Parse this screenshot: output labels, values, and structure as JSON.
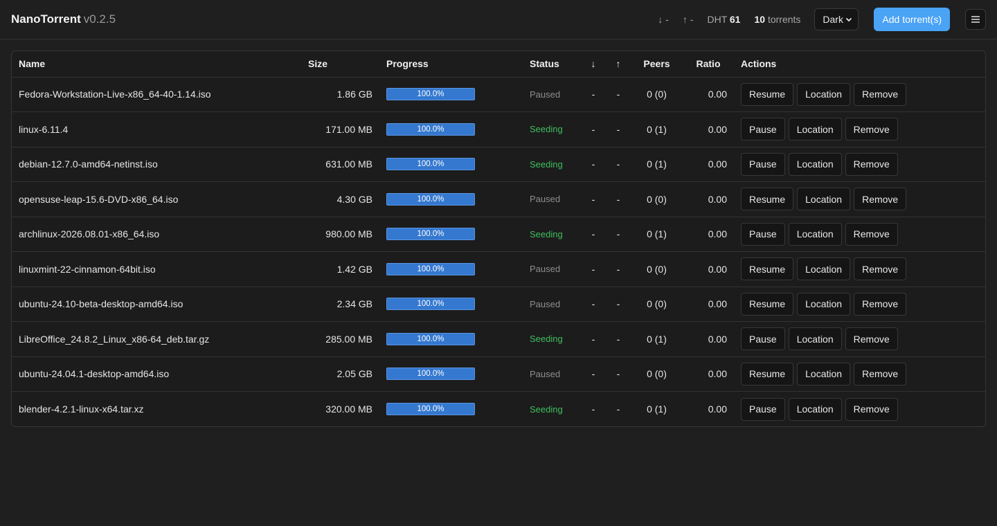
{
  "app": {
    "name": "NanoTorrent",
    "version": "v0.2.5"
  },
  "header": {
    "down_label": "↓ -",
    "up_label": "↑ -",
    "dht_label": "DHT",
    "dht_value": "61",
    "torrent_count": "10",
    "torrent_label": "torrents",
    "theme": "Dark",
    "add_button": "Add torrent(s)",
    "menu_icon": "hamburger-menu-icon"
  },
  "table": {
    "columns": [
      "Name",
      "Size",
      "Progress",
      "Status",
      "↓",
      "↑",
      "Peers",
      "Ratio",
      "Actions"
    ],
    "rows": [
      {
        "name": "Fedora-Workstation-Live-x86_64-40-1.14.iso",
        "size": "1.86 GB",
        "progress": 100.0,
        "progress_label": "100.0%",
        "status": "Paused",
        "down": "-",
        "up": "-",
        "peers": "0 (0)",
        "ratio": "0.00",
        "actions": [
          "Resume",
          "Location",
          "Remove"
        ]
      },
      {
        "name": "linux-6.11.4",
        "size": "171.00 MB",
        "progress": 100.0,
        "progress_label": "100.0%",
        "status": "Seeding",
        "down": "-",
        "up": "-",
        "peers": "0 (1)",
        "ratio": "0.00",
        "actions": [
          "Pause",
          "Location",
          "Remove"
        ]
      },
      {
        "name": "debian-12.7.0-amd64-netinst.iso",
        "size": "631.00 MB",
        "progress": 100.0,
        "progress_label": "100.0%",
        "status": "Seeding",
        "down": "-",
        "up": "-",
        "peers": "0 (1)",
        "ratio": "0.00",
        "actions": [
          "Pause",
          "Location",
          "Remove"
        ]
      },
      {
        "name": "opensuse-leap-15.6-DVD-x86_64.iso",
        "size": "4.30 GB",
        "progress": 100.0,
        "progress_label": "100.0%",
        "status": "Paused",
        "down": "-",
        "up": "-",
        "peers": "0 (0)",
        "ratio": "0.00",
        "actions": [
          "Resume",
          "Location",
          "Remove"
        ]
      },
      {
        "name": "archlinux-2026.08.01-x86_64.iso",
        "size": "980.00 MB",
        "progress": 100.0,
        "progress_label": "100.0%",
        "status": "Seeding",
        "down": "-",
        "up": "-",
        "peers": "0 (1)",
        "ratio": "0.00",
        "actions": [
          "Pause",
          "Location",
          "Remove"
        ]
      },
      {
        "name": "linuxmint-22-cinnamon-64bit.iso",
        "size": "1.42 GB",
        "progress": 100.0,
        "progress_label": "100.0%",
        "status": "Paused",
        "down": "-",
        "up": "-",
        "peers": "0 (0)",
        "ratio": "0.00",
        "actions": [
          "Resume",
          "Location",
          "Remove"
        ]
      },
      {
        "name": "ubuntu-24.10-beta-desktop-amd64.iso",
        "size": "2.34 GB",
        "progress": 100.0,
        "progress_label": "100.0%",
        "status": "Paused",
        "down": "-",
        "up": "-",
        "peers": "0 (0)",
        "ratio": "0.00",
        "actions": [
          "Resume",
          "Location",
          "Remove"
        ]
      },
      {
        "name": "LibreOffice_24.8.2_Linux_x86-64_deb.tar.gz",
        "size": "285.00 MB",
        "progress": 100.0,
        "progress_label": "100.0%",
        "status": "Seeding",
        "down": "-",
        "up": "-",
        "peers": "0 (1)",
        "ratio": "0.00",
        "actions": [
          "Pause",
          "Location",
          "Remove"
        ]
      },
      {
        "name": "ubuntu-24.04.1-desktop-amd64.iso",
        "size": "2.05 GB",
        "progress": 100.0,
        "progress_label": "100.0%",
        "status": "Paused",
        "down": "-",
        "up": "-",
        "peers": "0 (0)",
        "ratio": "0.00",
        "actions": [
          "Resume",
          "Location",
          "Remove"
        ]
      },
      {
        "name": "blender-4.2.1-linux-x64.tar.xz",
        "size": "320.00 MB",
        "progress": 100.0,
        "progress_label": "100.0%",
        "status": "Seeding",
        "down": "-",
        "up": "-",
        "peers": "0 (1)",
        "ratio": "0.00",
        "actions": [
          "Pause",
          "Location",
          "Remove"
        ]
      }
    ]
  },
  "colors": {
    "accent": "#4aa3f5",
    "seeding": "#3fbf5f",
    "paused": "#8e8e8e",
    "progress": "#3a7bd5"
  }
}
